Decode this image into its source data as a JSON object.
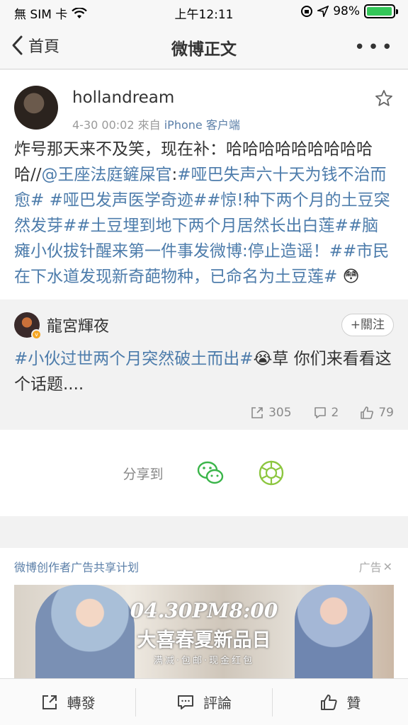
{
  "status_bar": {
    "carrier": "無 SIM 卡",
    "time": "上午12:11",
    "battery": "98%",
    "battery_level": 0.98,
    "battery_color": "#34c759"
  },
  "nav": {
    "back_label": "首頁",
    "title": "微博正文",
    "more": "•••"
  },
  "post": {
    "username": "hollandream",
    "date": "4-30 00:02",
    "source_prefix": "來自",
    "source": "iPhone 客户端",
    "text_plain": "炸号那天来不及笑，现在补：哈哈哈哈哈哈哈哈哈哈//",
    "mention": "@王座法庭鏟屎官",
    "colon": ":",
    "topics": "#哑巴失声六十天为钱不治而愈# #哑巴发声医学奇迹##惊!种下两个月的土豆突然发芽##土豆埋到地下两个月居然长出白莲##脑瘫小伙拔针醒来第一件事发微博:停止造谣！##市民在下水道发现新奇葩物种，已命名为土豆莲#",
    "emoji": "😳"
  },
  "repost": {
    "username": "龍宮輝夜",
    "follow_label": "+關注",
    "topic": "#小伙过世两个月突然破土而出#",
    "emoji": "😭",
    "text": "草 你们来看看这个话题....",
    "reposts": "305",
    "comments": "2",
    "likes": "79"
  },
  "share": {
    "label": "分享到"
  },
  "ad": {
    "title": "微博创作者广告共享计划",
    "tag": "广告",
    "close": "✕",
    "banner_line1": "04.30PM8:00",
    "banner_line2": "大喜春夏新品日",
    "banner_line3": "满减·包邮·现金红包"
  },
  "bottom_bar": {
    "repost": "轉發",
    "comment": "評論",
    "like": "贊"
  },
  "colors": {
    "link": "#4d7cab",
    "wechat": "#3bb54a",
    "moments": "#8cc63f"
  }
}
